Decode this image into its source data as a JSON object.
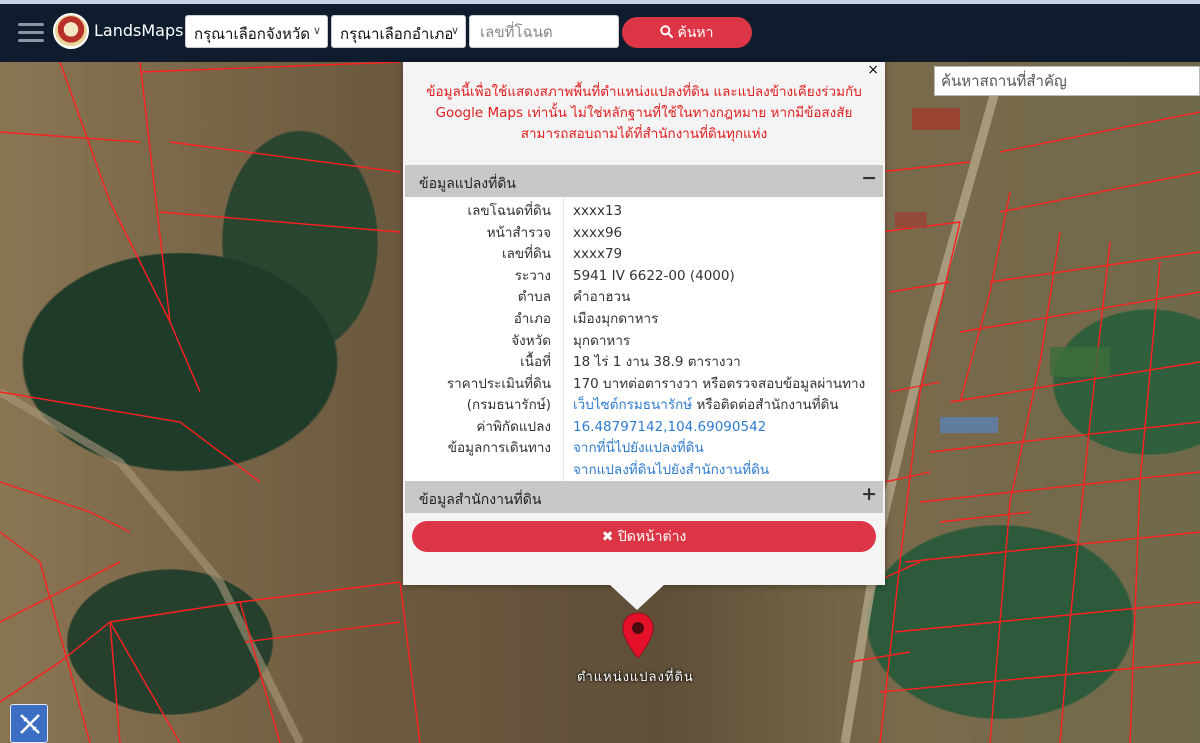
{
  "navbar": {
    "brand": "LandsMaps",
    "province_select": "กรุณาเลือกจังหวัด",
    "district_select": "กรุณาเลือกอำเภอ",
    "deed_placeholder": "เลขที่โฉนด",
    "search_label": "ค้นหา"
  },
  "map": {
    "poi_search_placeholder": "ค้นหาสถานที่สำคัญ",
    "marker_label": "ตำแหน่งแปลงที่ดิน"
  },
  "popup": {
    "close_glyph": "×",
    "disclaimer": "ข้อมูลนี้เพื่อใช้แสดงสภาพพื้นที่ตำแหน่งแปลงที่ดิน และแปลงข้างเคียงร่วมกับ Google Maps เท่านั้น ไม่ใช่หลักฐานที่ใช้ในทางกฎหมาย หากมีข้อสงสัยสามารถสอบถามได้ที่สำนักงานที่ดินทุกแห่ง",
    "land_section": {
      "title": "ข้อมูลแปลงที่ดิน",
      "toggle": "−"
    },
    "office_section": {
      "title": "ข้อมูลสำนักงานที่ดิน",
      "toggle": "+"
    },
    "rows": {
      "deed_no": {
        "label": "เลขโฉนดที่ดิน",
        "value": "xxxx13"
      },
      "survey_page": {
        "label": "หน้าสำรวจ",
        "value": "xxxx96"
      },
      "land_no": {
        "label": "เลขที่ดิน",
        "value": "xxxx79"
      },
      "ravang": {
        "label": "ระวาง",
        "value": "5941 IV 6622-00 (4000)"
      },
      "tambon": {
        "label": "ตำบล",
        "value": "คำอาฮวน"
      },
      "amphoe": {
        "label": "อำเภอ",
        "value": "เมืองมุกดาหาร"
      },
      "province": {
        "label": "จังหวัด",
        "value": "มุกดาหาร"
      },
      "area": {
        "label": "เนื้อที่",
        "value": "18 ไร่ 1 งาน 38.9 ตารางวา"
      },
      "appraisal": {
        "label": "ราคาประเมินที่ดิน",
        "value": "170 บาทต่อตารางวา หรือตรวจสอบข้อมูลผ่านทาง"
      },
      "treasury": {
        "label": "(กรมธนารักษ์)",
        "link": "เว็บไซต์กรมธนารักษ์",
        "suffix": " หรือติดต่อสำนักงานที่ดิน"
      },
      "coords": {
        "label": "ค่าพิกัดแปลง",
        "value": "16.48797142,104.69090542"
      },
      "travel": {
        "label": "ข้อมูลการเดินทาง",
        "link1": "จากที่นี่ไปยังแปลงที่ดิน",
        "link2": "จากแปลงที่ดินไปยังสำนักงานที่ดิน"
      }
    },
    "close_button": "✖ ปิดหน้าต่าง"
  },
  "colors": {
    "navbar": "#0f1c2e",
    "accent_red": "#dc3545",
    "parcel_line": "#ff2020",
    "link": "#2f7bd0"
  },
  "icons": {
    "menu": "hamburger-icon",
    "search": "search-icon",
    "marker": "map-pin-icon",
    "tool": "ruler-pencil-icon"
  }
}
